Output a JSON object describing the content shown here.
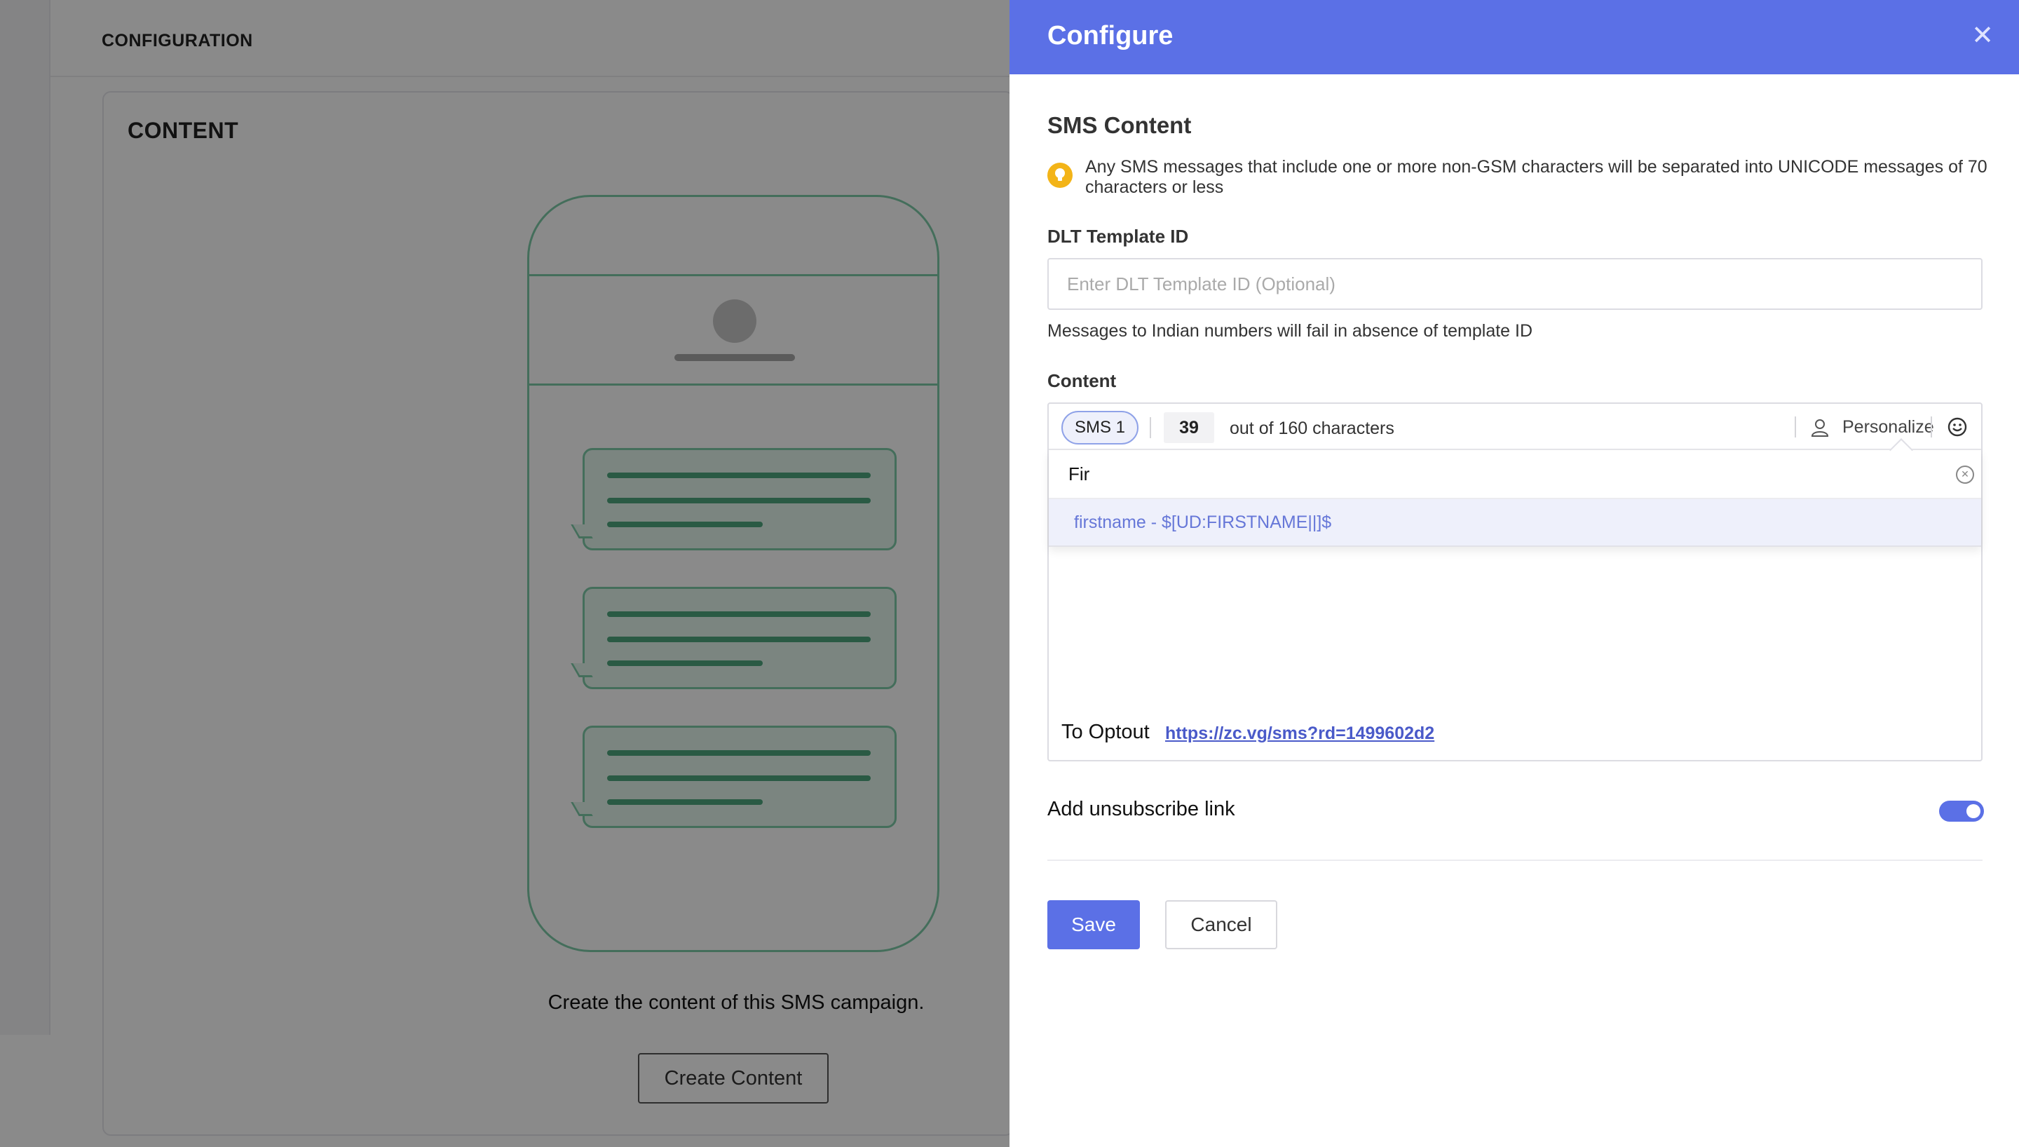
{
  "background": {
    "section_title": "CONFIGURATION",
    "card_title": "CONTENT",
    "prompt_text": "Create the content of this SMS campaign.",
    "create_button": "Create Content"
  },
  "panel": {
    "title": "Configure",
    "close_icon": "close-icon",
    "close_glyph": "✕",
    "sms_content_title": "SMS Content",
    "note_icon": "lightbulb-icon",
    "note_text": "Any SMS messages that include one or more non-GSM characters will be separated into UNICODE messages of 70 characters or less",
    "dlt_label": "DLT Template ID",
    "dlt_value": "",
    "dlt_placeholder": "Enter DLT Template ID (Optional)",
    "dlt_help": "Messages to Indian numbers will fail in absence of template ID",
    "content_label": "Content",
    "editor": {
      "sms_tab": "SMS 1",
      "char_count": "39",
      "char_text": "out of 160 characters",
      "personalize_label": "Personalize",
      "personalize_icon": "user-icon",
      "emoji_icon": "smiley-icon",
      "search_value": "Fir",
      "clear_icon": "clear-circle-icon",
      "clear_glyph": "✕",
      "option": "firstname - $[UD:FIRSTNAME||]$",
      "optout_label": "To Optout",
      "optout_link": "https://zc.vg/sms?rd=1499602d2"
    },
    "unsubscribe_label": "Add unsubscribe link",
    "unsubscribe_on": true,
    "save_label": "Save",
    "cancel_label": "Cancel"
  },
  "colors": {
    "accent": "#5b70e6",
    "note_icon": "#f3b418",
    "phone_outline": "#7fcba8"
  }
}
